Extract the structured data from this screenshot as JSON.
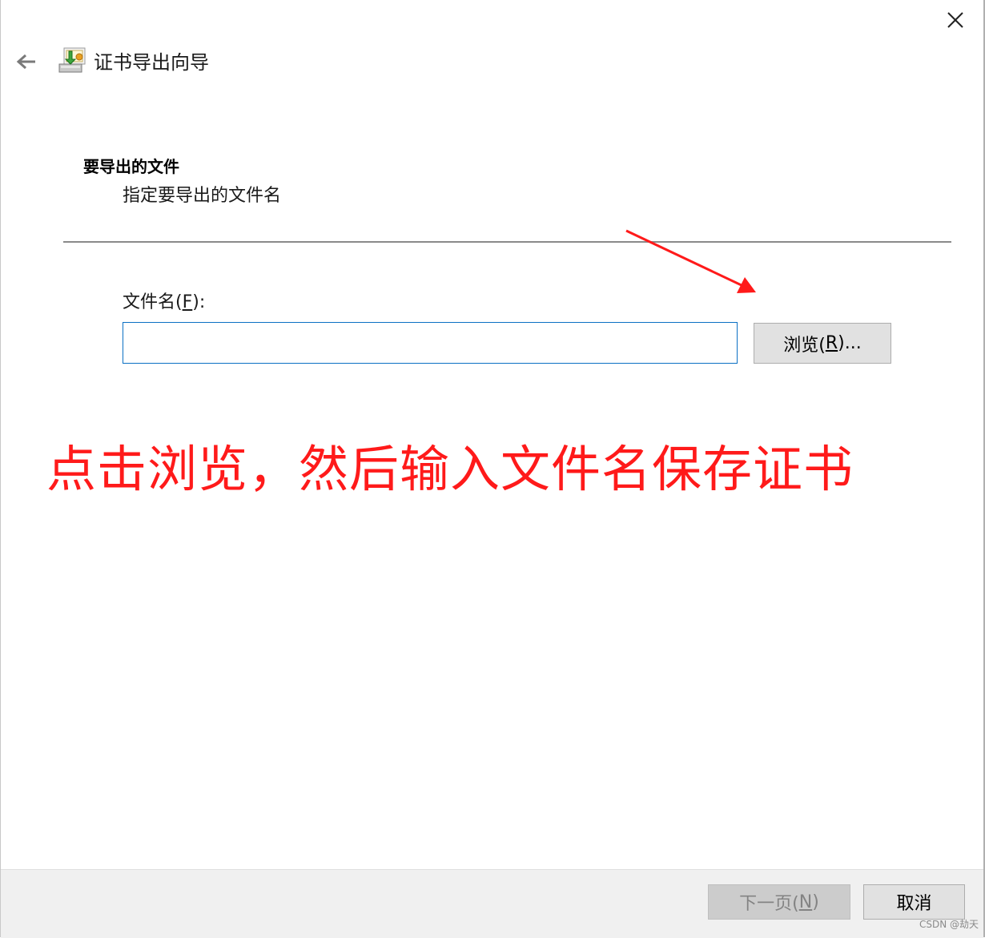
{
  "window": {
    "title": "证书导出向导"
  },
  "section": {
    "title": "要导出的文件",
    "subtitle": "指定要导出的文件名"
  },
  "file": {
    "label_prefix": "文件名(",
    "label_key": "F",
    "label_suffix": "):",
    "value": "",
    "browse_prefix": "浏览(",
    "browse_key": "R",
    "browse_suffix": ")..."
  },
  "annotation": {
    "text": "点击浏览，然后输入文件名保存证书",
    "color": "#ff1a1a"
  },
  "footer": {
    "next_prefix": "下一页(",
    "next_key": "N",
    "next_suffix": ")",
    "cancel_label": "取消"
  },
  "watermark": "CSDN @劫天",
  "icons": {
    "close": "close-icon",
    "back": "back-arrow-icon",
    "wizard": "certificate-wizard-icon"
  },
  "colors": {
    "input_border": "#0b70c4",
    "annotation": "#ff1a1a"
  }
}
